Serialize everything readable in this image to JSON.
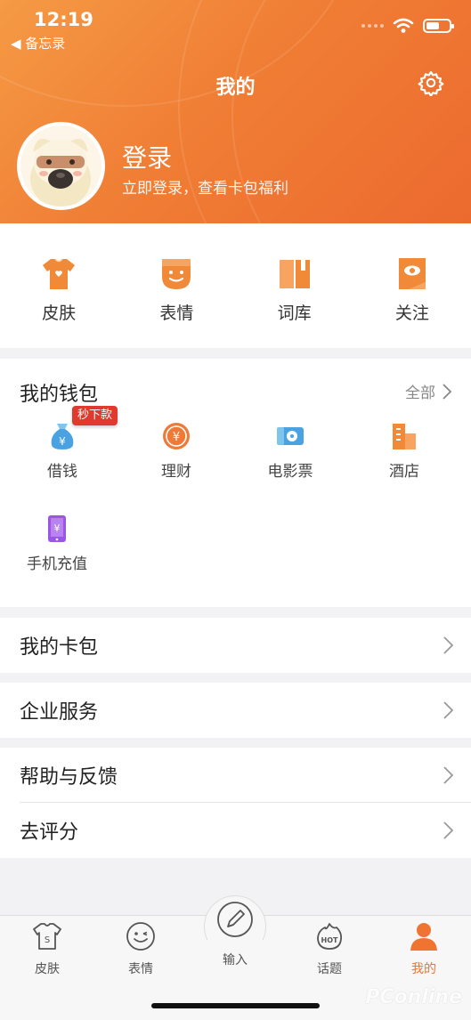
{
  "status": {
    "time": "12:19",
    "back_app": "◀ 备忘录"
  },
  "header": {
    "title": "我的",
    "login_title": "登录",
    "login_sub": "立即登录，查看卡包福利"
  },
  "quick_actions": [
    {
      "label": "皮肤",
      "icon": "tshirt-icon"
    },
    {
      "label": "表情",
      "icon": "smile-icon"
    },
    {
      "label": "词库",
      "icon": "book-icon"
    },
    {
      "label": "关注",
      "icon": "eye-flag-icon"
    }
  ],
  "wallet": {
    "title": "我的钱包",
    "all_label": "全部",
    "badge": "秒下款",
    "items": [
      {
        "label": "借钱",
        "icon": "money-bag-icon"
      },
      {
        "label": "理财",
        "icon": "yuan-coin-icon"
      },
      {
        "label": "电影票",
        "icon": "film-ticket-icon"
      },
      {
        "label": "酒店",
        "icon": "hotel-icon"
      },
      {
        "label": "手机充值",
        "icon": "phone-recharge-icon"
      }
    ]
  },
  "menu": {
    "card_pack": "我的卡包",
    "enterprise": "企业服务",
    "help": "帮助与反馈",
    "rate": "去评分"
  },
  "tabs": [
    {
      "label": "皮肤",
      "icon": "tshirt-outline-icon"
    },
    {
      "label": "表情",
      "icon": "smile-outline-icon"
    },
    {
      "label": "输入",
      "icon": "pen-icon"
    },
    {
      "label": "话题",
      "icon": "hot-topic-icon"
    },
    {
      "label": "我的",
      "icon": "person-icon"
    }
  ],
  "watermark": "PConline",
  "colors": {
    "accent": "#ef7431",
    "badge": "#e03a2e"
  }
}
